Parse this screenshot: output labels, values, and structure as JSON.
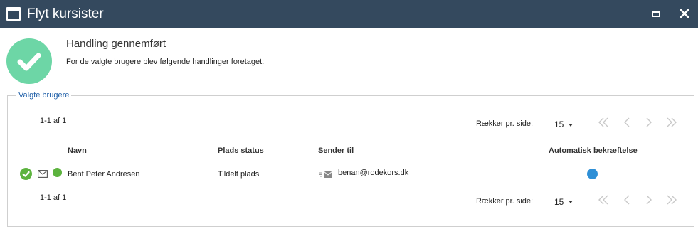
{
  "window": {
    "title": "Flyt kursister"
  },
  "result": {
    "heading": "Handling gennemført",
    "message": "For de valgte brugere blev følgende handlinger foretaget:"
  },
  "users_panel": {
    "legend": "Valgte brugere",
    "count_top": "1-1 af 1",
    "count_bottom": "1-1 af 1",
    "rows_per_page_label": "Rækker pr. side:",
    "rows_per_page_value": "15",
    "columns": {
      "name": "Navn",
      "seat_status": "Plads status",
      "send_to": "Sender til",
      "auto_confirm": "Automatisk bekræftelse"
    },
    "rows": [
      {
        "name": "Bent Peter Andresen",
        "seat_status": "Tildelt plads",
        "send_to": "benan@rodekors.dk"
      }
    ]
  },
  "colors": {
    "titlebar": "#34495e",
    "success": "#6dd6a6",
    "status_green": "#5cb33e",
    "auto_confirm_blue": "#2e8fd6",
    "legend_blue": "#1f5fa8"
  },
  "icons": {
    "window": "window-icon",
    "maximize": "maximize-icon",
    "close": "close-icon",
    "success": "checkmark-circle-icon",
    "mail": "envelope-icon",
    "send": "send-mail-icon"
  }
}
